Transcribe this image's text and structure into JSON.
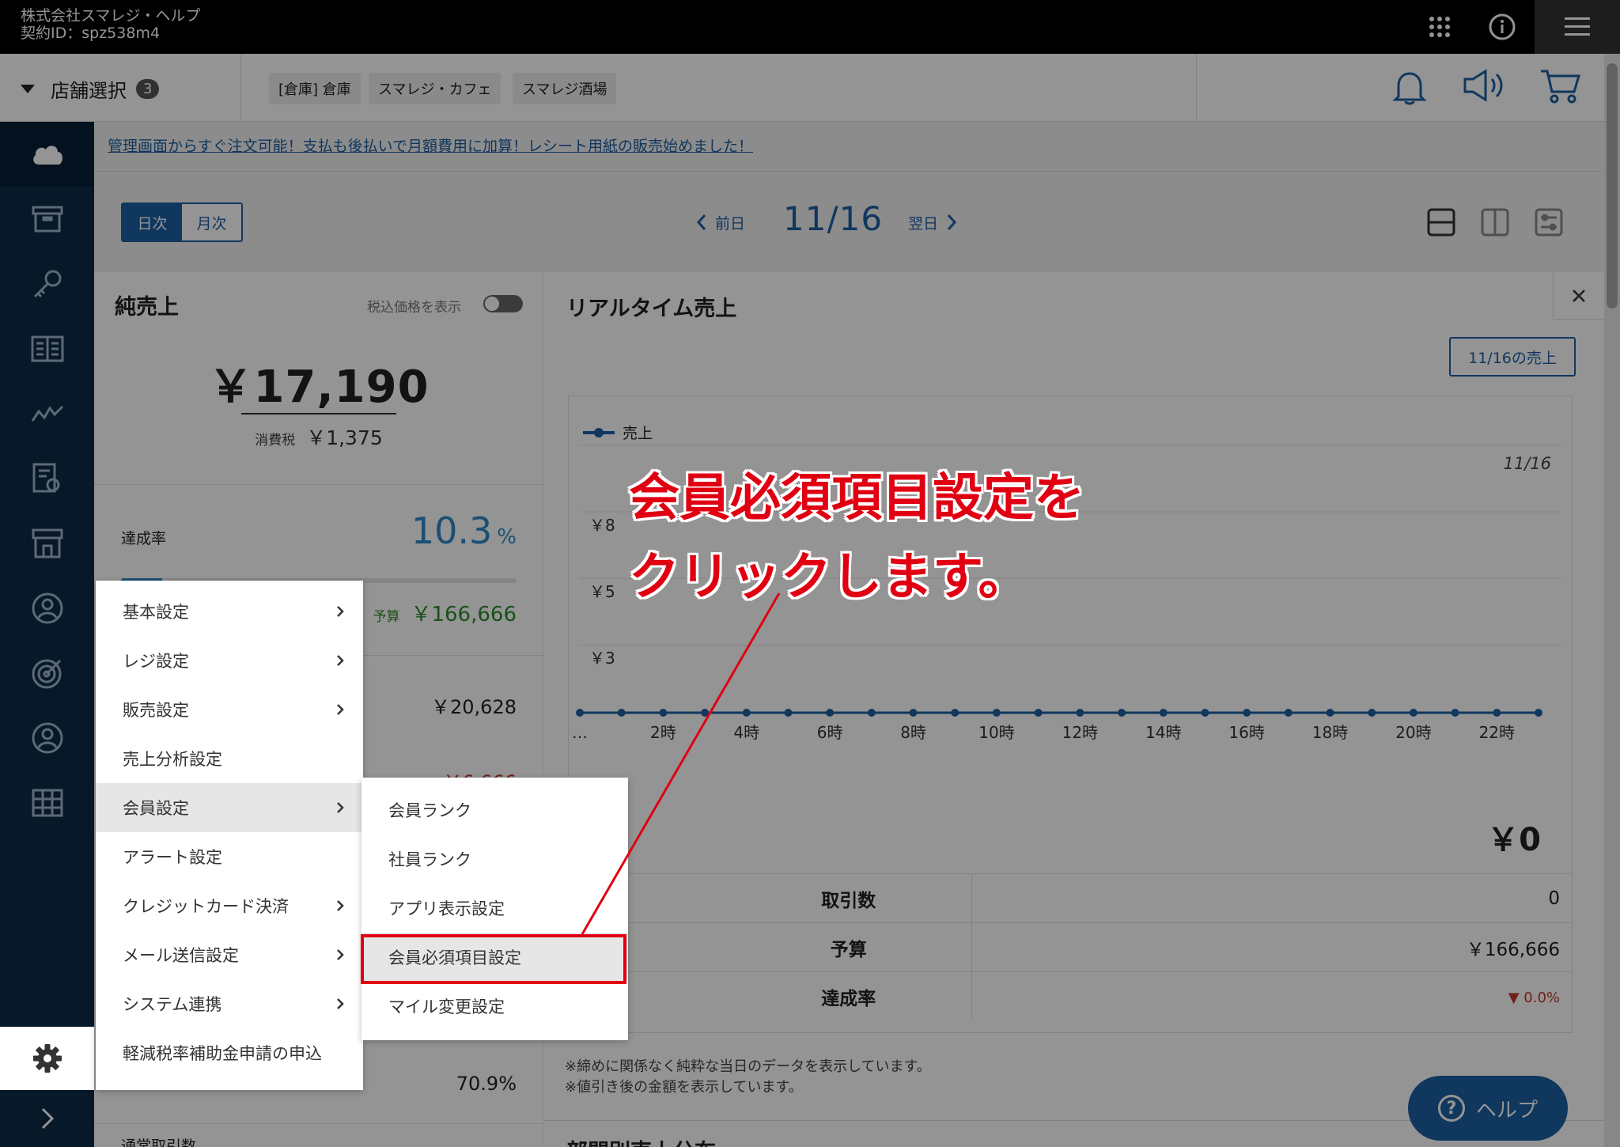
{
  "header": {
    "company": "株式会社スマレジ・ヘルプ",
    "contract_id": "契約ID：spz538m4"
  },
  "storebar": {
    "label": "店舗選択",
    "count": "3",
    "chips": [
      "[倉庫] 倉庫",
      "スマレジ・カフェ",
      "スマレジ酒場"
    ]
  },
  "announcement": "管理画面からすぐ注文可能！支払も後払いで月額費用に加算！レシート用紙の販売始めました！",
  "toolbar": {
    "daily": "日次",
    "monthly": "月次",
    "prev": "前日",
    "date": "11/16",
    "next": "翌日"
  },
  "net_sales": {
    "title": "純売上",
    "toggle_label": "税込価格を表示",
    "amount": "￥17,190",
    "tax_label": "消費税",
    "tax_value": "￥1,375",
    "rate_label": "達成率",
    "rate_value": "10.3",
    "rate_unit": "%",
    "progress": 0.103,
    "budget_label": "予算",
    "budget_value": "￥166,666",
    "row_value_1": "￥20,628",
    "row_value_2": "￥6,666",
    "row_value_3": "70.9%",
    "row_label_bottom": "通常取引数"
  },
  "realtime": {
    "title": "リアルタイム売上",
    "button": "11/16の売上",
    "total": "￥0",
    "stats": [
      {
        "label": "取引数",
        "value": "0"
      },
      {
        "label": "予算",
        "value": "￥166,666"
      },
      {
        "label": "達成率",
        "value": "0.0%"
      }
    ],
    "notes": [
      "※締めに関係なく純粋な当日のデータを表示しています。",
      "※値引き後の金額を表示しています。"
    ],
    "next_section": "部門別売上分布"
  },
  "chart_data": {
    "type": "line",
    "title": "",
    "legend": "売上",
    "date_label": "11/16",
    "y_ticks": [
      "￥8",
      "￥5",
      "￥3"
    ],
    "x_tick_labels": [
      "…",
      "2時",
      "4時",
      "6時",
      "8時",
      "10時",
      "12時",
      "14時",
      "16時",
      "18時",
      "20時",
      "22時"
    ],
    "x": [
      0,
      1,
      2,
      3,
      4,
      5,
      6,
      7,
      8,
      9,
      10,
      11,
      12,
      13,
      14,
      15,
      16,
      17,
      18,
      19,
      20,
      21,
      22,
      23
    ],
    "series": [
      {
        "name": "売上",
        "values": [
          0,
          0,
          0,
          0,
          0,
          0,
          0,
          0,
          0,
          0,
          0,
          0,
          0,
          0,
          0,
          0,
          0,
          0,
          0,
          0,
          0,
          0,
          0,
          0
        ]
      }
    ],
    "color": "#1c5fa3"
  },
  "menu": {
    "items": [
      {
        "label": "基本設定",
        "sub": true
      },
      {
        "label": "レジ設定",
        "sub": true
      },
      {
        "label": "販売設定",
        "sub": true
      },
      {
        "label": "売上分析設定",
        "sub": false
      },
      {
        "label": "会員設定",
        "sub": true
      },
      {
        "label": "アラート設定",
        "sub": false
      },
      {
        "label": "クレジットカード決済",
        "sub": true
      },
      {
        "label": "メール送信設定",
        "sub": true
      },
      {
        "label": "システム連携",
        "sub": true
      },
      {
        "label": "軽減税率補助金申請の申込",
        "sub": false
      }
    ],
    "submenu": [
      "会員ランク",
      "社員ランク",
      "アプリ表示設定",
      "会員必須項目設定",
      "マイル変更設定"
    ]
  },
  "annotation": {
    "line1": "会員必須項目設定を",
    "line2": "クリックします。"
  },
  "help_label": "ヘルプ",
  "colors": {
    "accent": "#1c5fa3",
    "sidebar": "#0d2a48",
    "highlight": "#e00012",
    "rate": "#2f8ac9",
    "budget": "#2b8a2b"
  }
}
